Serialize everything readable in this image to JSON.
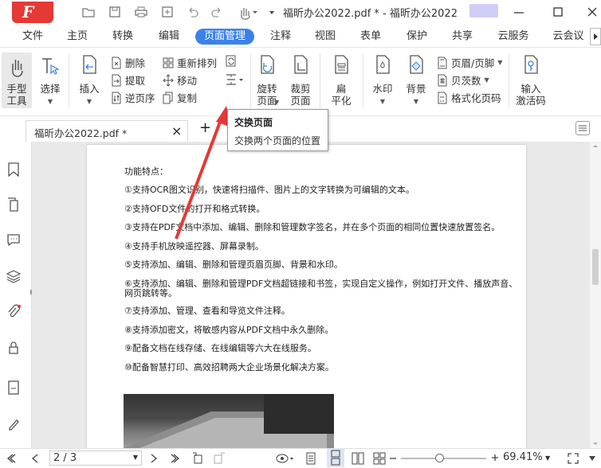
{
  "app": {
    "logo_letter": "F",
    "doc_title": "福昕办公2022.pdf * - 福昕办公2022"
  },
  "menu": {
    "tabs": [
      "文件",
      "主页",
      "转换",
      "编辑",
      "页面管理",
      "注释",
      "视图",
      "表单",
      "保护",
      "共享",
      "云服务",
      "云会议"
    ],
    "active": "页面管理"
  },
  "ribbon": {
    "hand_tool": "手型\n工具",
    "select": "选择",
    "insert": "插入",
    "delete": "删除",
    "extract": "提取",
    "reverse": "逆页序",
    "rearrange": "重新排列",
    "move": "移动",
    "copy": "复制",
    "rotate_page": "旋转\n页面",
    "crop_page": "裁剪\n页面",
    "flatten": "扁\n平化",
    "watermark": "水印",
    "background": "背景",
    "header_footer": "页眉/页脚",
    "bates": "贝茨数",
    "format_page_no": "格式化页码",
    "activation_code": "输入\n激活码"
  },
  "tooltip": {
    "title": "交换页面",
    "desc": "交换两个页面的位置"
  },
  "doc_tab": {
    "label": "福昕办公2022.pdf *",
    "close": "×",
    "new": "+"
  },
  "document": {
    "heading": "功能特点：",
    "lines": [
      "①支持OCR图文识别，快速将扫描件、图片上的文字转换为可编辑的文本。",
      "②支持OFD文件的打开和格式转换。",
      "③支持在PDF文档中添加、编辑、删除和管理数字签名，并在多个页面的相同位置快速放置签名。",
      "④支持手机放映遥控器、屏幕录制。",
      "⑤支持添加、编辑、删除和管理页眉页脚、背景和水印。",
      "⑥支持添加、编辑、删除和管理PDF文档超链接和书签，实现自定义操作，例如打开文件、播放声音、",
      "网页跳转等。",
      "⑦支持添加、管理、查看和导览文件注释。",
      "⑧支持添加密文，将敏感内容从PDF文档中永久删除。",
      "⑨配备文档在线存储、在线编辑等六大在线服务。",
      "⑩配备智慧打印、高效招聘两大企业场景化解决方案。"
    ]
  },
  "status": {
    "page": "2 / 3",
    "zoom": "69.41%",
    "zoom_level": 0.4
  },
  "colors": {
    "accent": "#3b82e8",
    "brand": "#e53935",
    "highlight": "#e53935"
  }
}
